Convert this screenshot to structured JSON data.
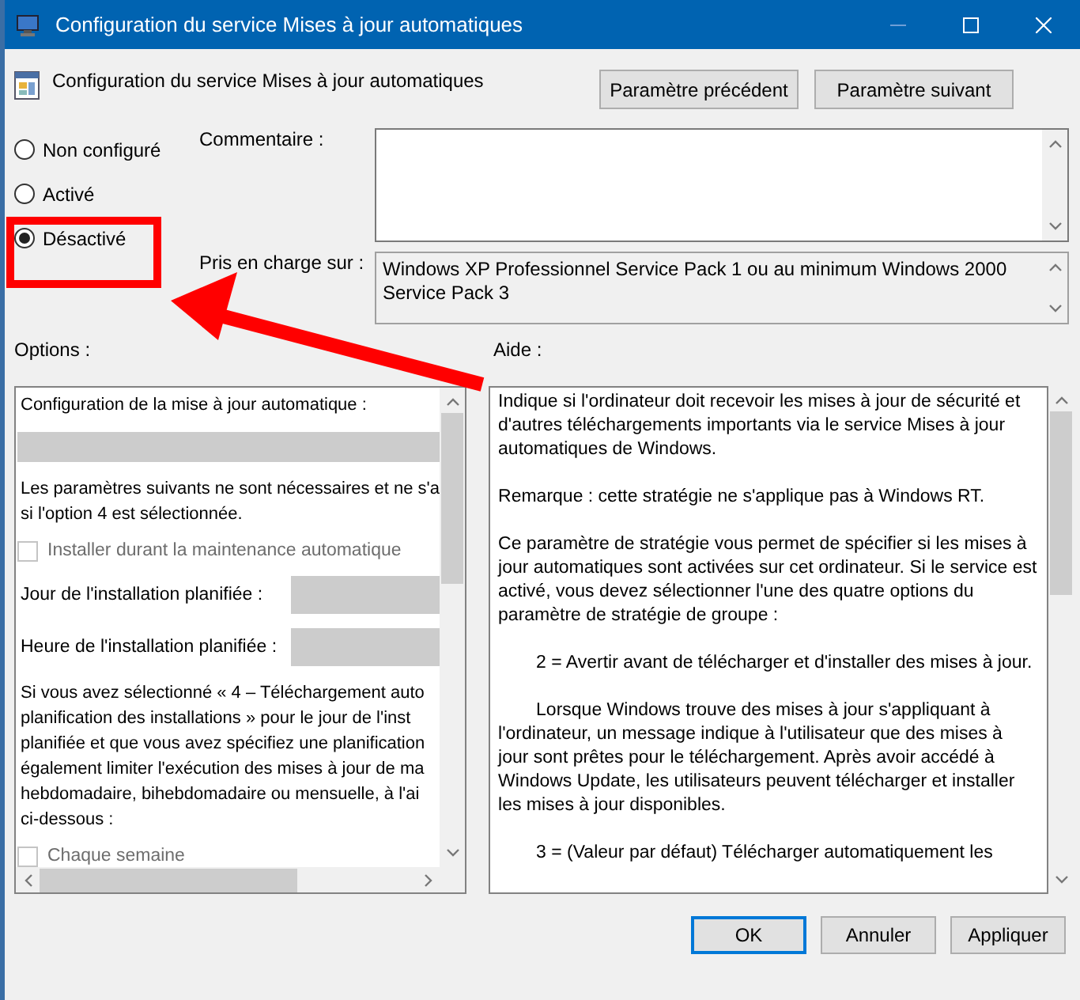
{
  "window": {
    "title": "Configuration du service Mises à jour automatiques"
  },
  "header": {
    "title": "Configuration du service Mises à jour automatiques",
    "buttons": [
      "Paramètre précédent",
      "Paramètre suivant"
    ]
  },
  "states": [
    {
      "label": "Non configuré",
      "selected": false
    },
    {
      "label": "Activé",
      "selected": false
    },
    {
      "label": "Désactivé",
      "selected": true
    }
  ],
  "comment": {
    "label": "Commentaire :"
  },
  "supported": {
    "label": "Pris en charge sur :",
    "value": "Windows XP Professionnel Service Pack 1 ou au minimum Windows 2000 Service Pack 3"
  },
  "options": {
    "label": "Options :",
    "items": [
      {
        "kind": "text",
        "lines": [
          "Configuration de la mise à jour automatique :"
        ]
      },
      {
        "kind": "dropdown",
        "disabled": true
      },
      {
        "kind": "text",
        "lines": [
          "Les paramètres suivants ne sont nécessaires et ne s'a",
          "si l'option 4 est sélectionnée."
        ]
      },
      {
        "kind": "checkbox",
        "label": "Installer durant la maintenance automatique",
        "checked": false,
        "disabled": true
      },
      {
        "kind": "field",
        "label": "Jour de l'installation planifiée :",
        "disabled": true
      },
      {
        "kind": "field",
        "label": "Heure de l'installation planifiée :",
        "disabled": true
      },
      {
        "kind": "text",
        "lines": [
          "Si vous avez sélectionné « 4 – Téléchargement auto",
          "planification  des  installations » pour le jour de l'inst",
          "planifiée et que vous avez spécifiez une planification",
          "également limiter l'exécution des mises à jour de ma",
          "hebdomadaire, bihebdomadaire ou mensuelle, à l'ai",
          "ci-dessous :"
        ]
      },
      {
        "kind": "checkbox",
        "label": "Chaque semaine",
        "checked": false,
        "disabled": true
      }
    ]
  },
  "help": {
    "label": "Aide :",
    "paragraphs": [
      {
        "kind": "plain",
        "text": "Indique si l'ordinateur doit recevoir les mises à jour de sécurité et d'autres téléchargements importants via le service Mises à jour automatiques de Windows."
      },
      {
        "kind": "plain",
        "text": "Remarque : cette stratégie ne s'applique pas à Windows RT."
      },
      {
        "kind": "plain",
        "text": "Ce paramètre de stratégie vous permet de spécifier si les mises à jour automatiques sont activées sur cet ordinateur. Si le service est activé, vous devez sélectionner l'une des quatre options du paramètre de stratégie de groupe :"
      },
      {
        "kind": "indented",
        "text": "2 = Avertir avant de télécharger et d'installer des mises à jour."
      },
      {
        "kind": "indented",
        "text": "Lorsque Windows trouve des mises à jour s'appliquant à l'ordinateur, un message indique à l'utilisateur que des mises à jour sont prêtes pour le téléchargement. Après avoir accédé à Windows Update, les utilisateurs peuvent télécharger et installer les mises à jour disponibles."
      },
      {
        "kind": "indented",
        "text": "3 = (Valeur par défaut) Télécharger automatiquement les"
      }
    ]
  },
  "footer": {
    "buttons": [
      {
        "label": "OK",
        "selected": true
      },
      {
        "label": "Annuler",
        "selected": false
      },
      {
        "label": "Appliquer",
        "selected": false
      }
    ]
  }
}
